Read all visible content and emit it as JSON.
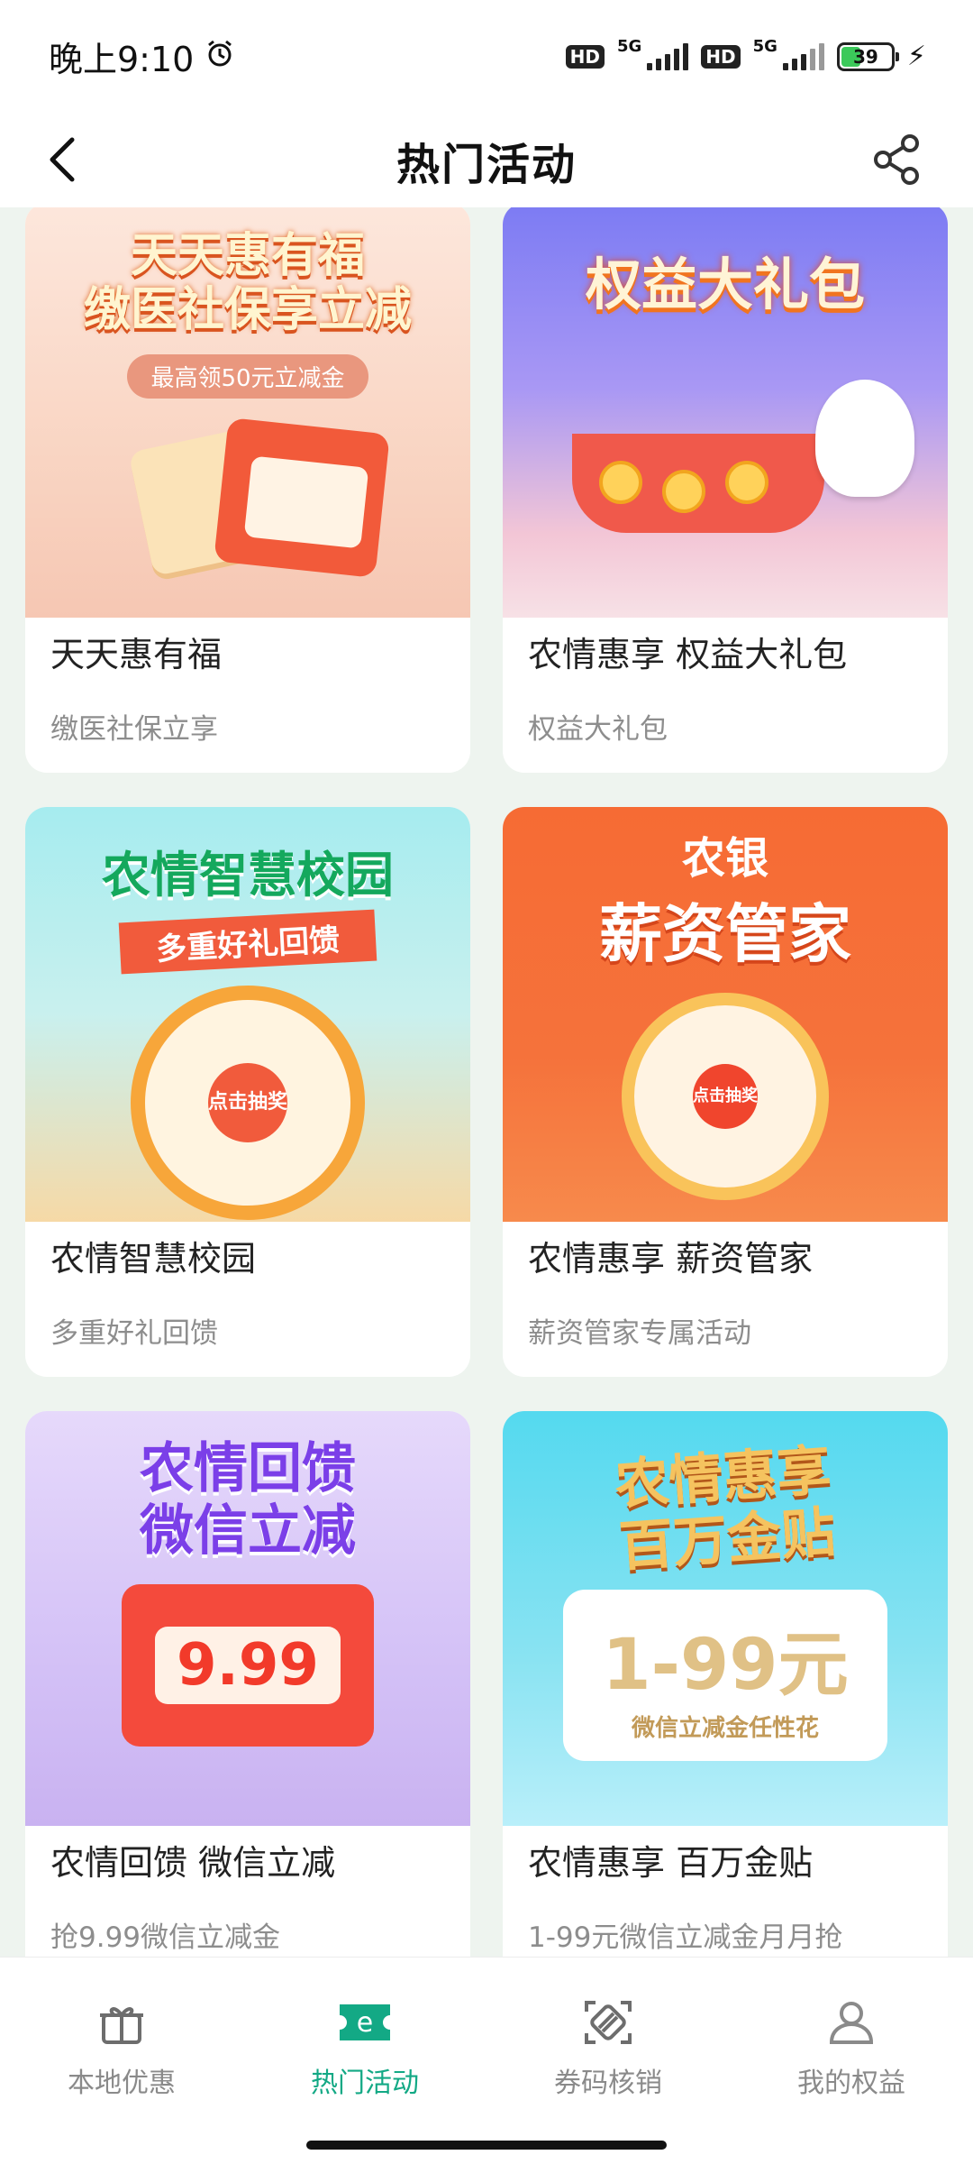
{
  "status_bar": {
    "time": "晚上9:10",
    "network1": "5G",
    "network2": "5G",
    "hd1": "HD",
    "hd2": "HD",
    "battery_level": "39",
    "battery_fraction": 0.39
  },
  "nav": {
    "title": "热门活动"
  },
  "cards": [
    {
      "title": "天天惠有福",
      "subtitle": "缴医社保立享",
      "banner_line1": "天天惠有福",
      "banner_line2": "缴医社保享立减",
      "banner_pill": "最高领50元立减金"
    },
    {
      "title": "农情惠享  权益大礼包",
      "subtitle": "权益大礼包",
      "banner_line1": "权益大礼包"
    },
    {
      "title": "农情智慧校园",
      "subtitle": "多重好礼回馈",
      "banner_line1": "农情智慧校园",
      "banner_ribbon": "多重好礼回馈",
      "wheel_center": "点击抽奖"
    },
    {
      "title": "农情惠享 薪资管家",
      "subtitle": "薪资管家专属活动",
      "banner_line1": "农银",
      "banner_line2": "薪资管家",
      "wheel_center": "点击抽奖"
    },
    {
      "title": "农情回馈 微信立减",
      "subtitle": "抢9.99微信立减金",
      "banner_line1": "农情回馈",
      "banner_line2": "微信立减",
      "banner_amount": "9.99"
    },
    {
      "title": "农情惠享 百万金贴",
      "subtitle": "1-99元微信立减金月月抢",
      "banner_line1": "农情惠享",
      "banner_line2": "百万金贴",
      "banner_amount": "1-99元",
      "banner_note": "微信立减金任性花"
    }
  ],
  "tabs": [
    {
      "label": "本地优惠",
      "icon": "gift-icon",
      "active": false
    },
    {
      "label": "热门活动",
      "icon": "e-ticket-icon",
      "active": true
    },
    {
      "label": "券码核销",
      "icon": "scan-coupon-icon",
      "active": false
    },
    {
      "label": "我的权益",
      "icon": "user-icon",
      "active": false
    }
  ],
  "colors": {
    "accent": "#13a985",
    "background": "#eef4ef",
    "tab_inactive": "#8a8a8a"
  }
}
